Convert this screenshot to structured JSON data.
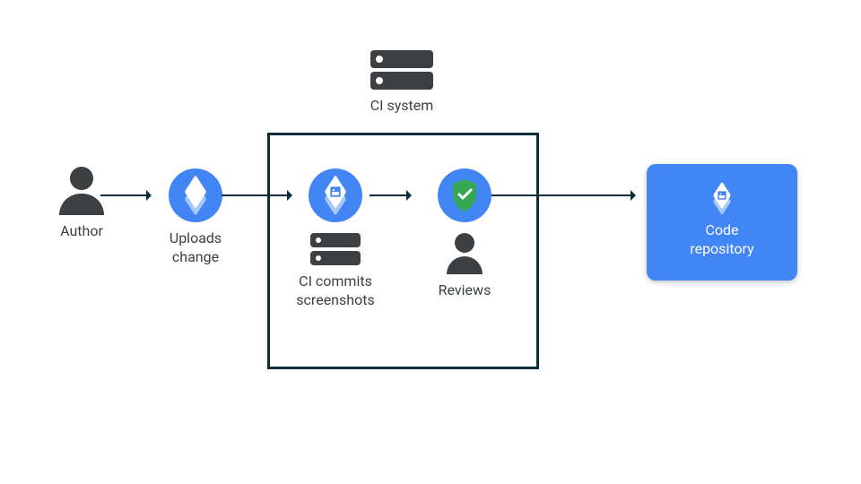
{
  "author_label": "Author",
  "uploads_label1": "Uploads",
  "uploads_label2": "change",
  "ci_system_label": "CI system",
  "ci_commits_label1": "CI commits",
  "ci_commits_label2": "screenshots",
  "reviews_label": "Reviews",
  "repo_label1": "Code",
  "repo_label2": "repository"
}
